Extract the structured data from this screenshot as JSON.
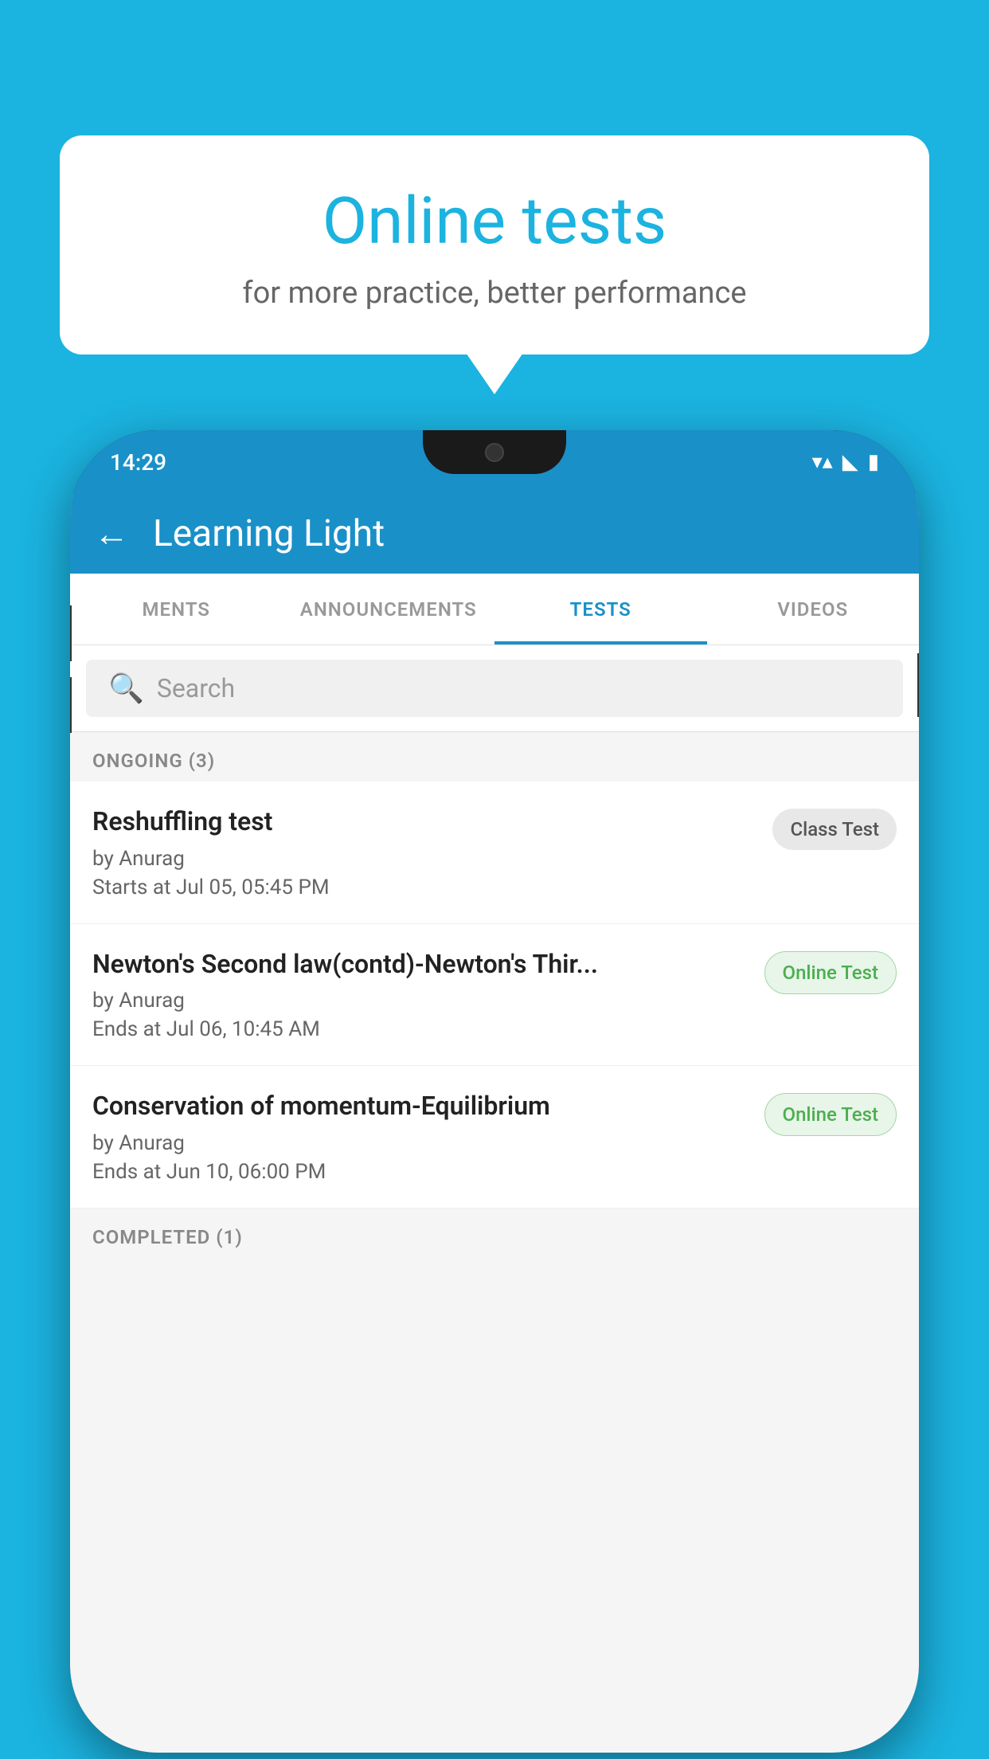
{
  "background": {
    "color": "#1bb3e0"
  },
  "speech_bubble": {
    "title": "Online tests",
    "subtitle": "for more practice, better performance"
  },
  "phone": {
    "status_bar": {
      "time": "14:29",
      "wifi_icon": "▼",
      "signal_icon": "▲",
      "battery_icon": "▮"
    },
    "app_bar": {
      "back_label": "←",
      "title": "Learning Light"
    },
    "tabs": [
      {
        "label": "MENTS",
        "active": false
      },
      {
        "label": "ANNOUNCEMENTS",
        "active": false
      },
      {
        "label": "TESTS",
        "active": true
      },
      {
        "label": "VIDEOS",
        "active": false
      }
    ],
    "search": {
      "placeholder": "Search"
    },
    "sections": [
      {
        "header": "ONGOING (3)",
        "items": [
          {
            "title": "Reshuffling test",
            "author": "by Anurag",
            "date": "Starts at  Jul 05, 05:45 PM",
            "badge": "Class Test",
            "badge_type": "class"
          },
          {
            "title": "Newton's Second law(contd)-Newton's Thir...",
            "author": "by Anurag",
            "date": "Ends at  Jul 06, 10:45 AM",
            "badge": "Online Test",
            "badge_type": "online"
          },
          {
            "title": "Conservation of momentum-Equilibrium",
            "author": "by Anurag",
            "date": "Ends at  Jun 10, 06:00 PM",
            "badge": "Online Test",
            "badge_type": "online"
          }
        ]
      },
      {
        "header": "COMPLETED (1)",
        "items": []
      }
    ]
  }
}
